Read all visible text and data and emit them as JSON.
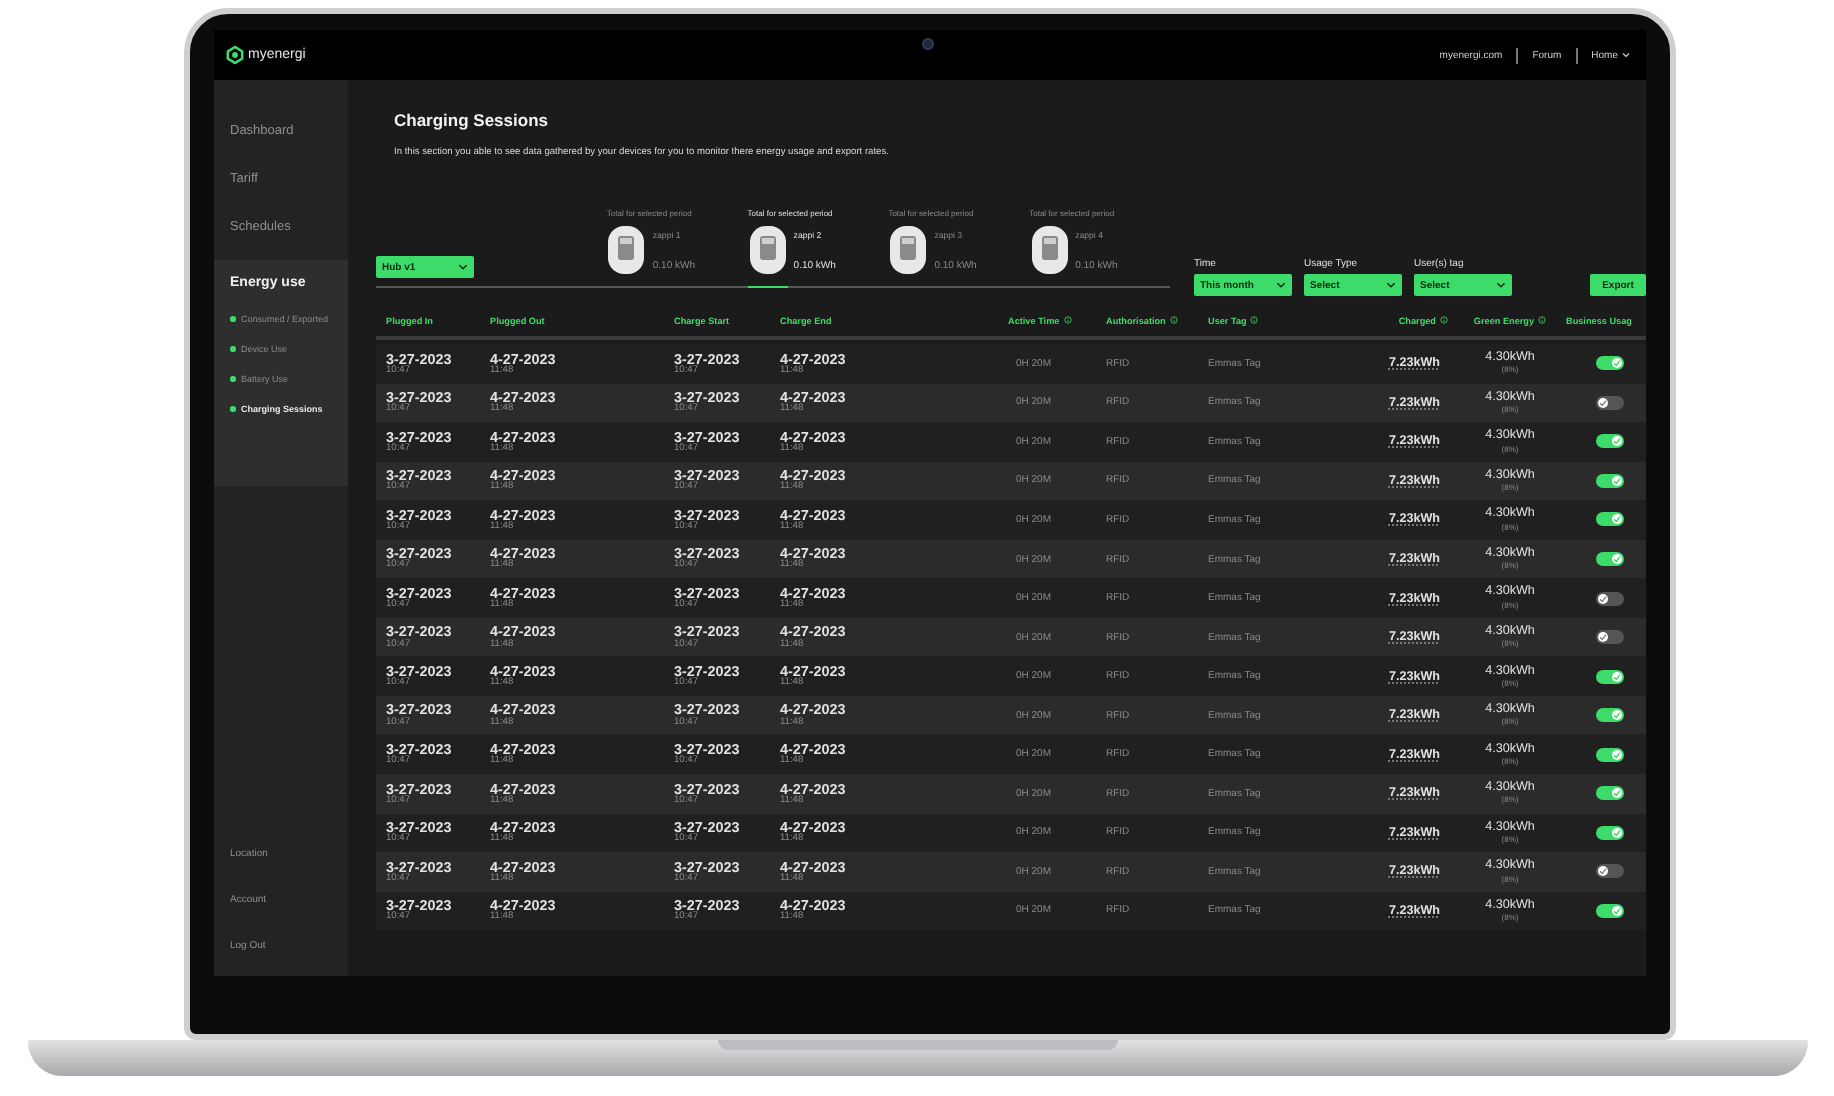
{
  "nav": {
    "logo": "myenergi",
    "links": [
      {
        "label": "myenergi.com",
        "dropdown": false
      },
      {
        "label": "Forum",
        "dropdown": false
      },
      {
        "label": "Home",
        "dropdown": true
      }
    ]
  },
  "sidebar": {
    "items": [
      {
        "label": "Dashboard",
        "selected": false
      },
      {
        "label": "Tariff",
        "selected": false
      },
      {
        "label": "Schedules",
        "selected": false
      },
      {
        "label": "Energy use",
        "selected": true,
        "children": [
          {
            "label": "Consumed / Exported",
            "selected": false
          },
          {
            "label": "Device Use",
            "selected": false
          },
          {
            "label": "Battery Use",
            "selected": false
          },
          {
            "label": "Charging Sessions",
            "selected": true
          }
        ]
      }
    ],
    "footer_items": [
      {
        "label": "Location"
      },
      {
        "label": "Account"
      },
      {
        "label": "Log Out"
      }
    ]
  },
  "page": {
    "title": "Charging Sessions",
    "description": "In this section you able to see data gathered by your devices for you to monitor there energy usage and export rates."
  },
  "hub_select": {
    "value": "Hub v1"
  },
  "devices": [
    {
      "caption": "Total for selected period",
      "name": "zappi 1",
      "energy": "0.10 kWh",
      "selected": false
    },
    {
      "caption": "Total for selected period",
      "name": "zappi 2",
      "energy": "0.10 kWh",
      "selected": true
    },
    {
      "caption": "Total for selected period",
      "name": "zappi 3",
      "energy": "0.10 kWh",
      "selected": false
    },
    {
      "caption": "Total for selected period",
      "name": "zappi 4",
      "energy": "0.10 kWh",
      "selected": false
    }
  ],
  "filters": [
    {
      "label": "Time",
      "value": "This month"
    },
    {
      "label": "Usage Type",
      "value": "Select"
    },
    {
      "label": "User(s) tag",
      "value": "Select"
    }
  ],
  "export_button": "Export",
  "table": {
    "columns": [
      {
        "label": "Plugged In",
        "info": false
      },
      {
        "label": "Plugged Out",
        "info": false
      },
      {
        "label": "Charge Start",
        "info": false
      },
      {
        "label": "Charge End",
        "info": false
      },
      {
        "label": "Active Time",
        "info": true
      },
      {
        "label": "Authorisation",
        "info": true
      },
      {
        "label": "User Tag",
        "info": true
      },
      {
        "label": "Charged",
        "info": true
      },
      {
        "label": "Green Energy",
        "info": true
      },
      {
        "label": "Business Usag",
        "info": false
      }
    ],
    "rows": [
      {
        "plugged_in": [
          "3-27-2023",
          "10:47"
        ],
        "plugged_out": [
          "4-27-2023",
          "11:48"
        ],
        "charge_start": [
          "3-27-2023",
          "10:47"
        ],
        "charge_end": [
          "4-27-2023",
          "11:48"
        ],
        "active_time": "0H  20M",
        "authorisation": "RFID",
        "user_tag": "Emmas Tag",
        "charged": "7.23kWh",
        "green_energy": "4.30kWh",
        "green_share": "(8%)",
        "business_usage": true
      },
      {
        "plugged_in": [
          "3-27-2023",
          "10:47"
        ],
        "plugged_out": [
          "4-27-2023",
          "11:48"
        ],
        "charge_start": [
          "3-27-2023",
          "10:47"
        ],
        "charge_end": [
          "4-27-2023",
          "11:48"
        ],
        "active_time": "0H  20M",
        "authorisation": "RFID",
        "user_tag": "Emmas Tag",
        "charged": "7.23kWh",
        "green_energy": "4.30kWh",
        "green_share": "(8%)",
        "business_usage": false
      },
      {
        "plugged_in": [
          "3-27-2023",
          "10:47"
        ],
        "plugged_out": [
          "4-27-2023",
          "11:48"
        ],
        "charge_start": [
          "3-27-2023",
          "10:47"
        ],
        "charge_end": [
          "4-27-2023",
          "11:48"
        ],
        "active_time": "0H  20M",
        "authorisation": "RFID",
        "user_tag": "Emmas Tag",
        "charged": "7.23kWh",
        "green_energy": "4.30kWh",
        "green_share": "(8%)",
        "business_usage": true
      },
      {
        "plugged_in": [
          "3-27-2023",
          "10:47"
        ],
        "plugged_out": [
          "4-27-2023",
          "11:48"
        ],
        "charge_start": [
          "3-27-2023",
          "10:47"
        ],
        "charge_end": [
          "4-27-2023",
          "11:48"
        ],
        "active_time": "0H  20M",
        "authorisation": "RFID",
        "user_tag": "Emmas Tag",
        "charged": "7.23kWh",
        "green_energy": "4.30kWh",
        "green_share": "(8%)",
        "business_usage": true
      },
      {
        "plugged_in": [
          "3-27-2023",
          "10:47"
        ],
        "plugged_out": [
          "4-27-2023",
          "11:48"
        ],
        "charge_start": [
          "3-27-2023",
          "10:47"
        ],
        "charge_end": [
          "4-27-2023",
          "11:48"
        ],
        "active_time": "0H  20M",
        "authorisation": "RFID",
        "user_tag": "Emmas Tag",
        "charged": "7.23kWh",
        "green_energy": "4.30kWh",
        "green_share": "(8%)",
        "business_usage": true
      },
      {
        "plugged_in": [
          "3-27-2023",
          "10:47"
        ],
        "plugged_out": [
          "4-27-2023",
          "11:48"
        ],
        "charge_start": [
          "3-27-2023",
          "10:47"
        ],
        "charge_end": [
          "4-27-2023",
          "11:48"
        ],
        "active_time": "0H  20M",
        "authorisation": "RFID",
        "user_tag": "Emmas Tag",
        "charged": "7.23kWh",
        "green_energy": "4.30kWh",
        "green_share": "(8%)",
        "business_usage": true
      },
      {
        "plugged_in": [
          "3-27-2023",
          "10:47"
        ],
        "plugged_out": [
          "4-27-2023",
          "11:48"
        ],
        "charge_start": [
          "3-27-2023",
          "10:47"
        ],
        "charge_end": [
          "4-27-2023",
          "11:48"
        ],
        "active_time": "0H  20M",
        "authorisation": "RFID",
        "user_tag": "Emmas Tag",
        "charged": "7.23kWh",
        "green_energy": "4.30kWh",
        "green_share": "(8%)",
        "business_usage": false
      },
      {
        "plugged_in": [
          "3-27-2023",
          "10:47"
        ],
        "plugged_out": [
          "4-27-2023",
          "11:48"
        ],
        "charge_start": [
          "3-27-2023",
          "10:47"
        ],
        "charge_end": [
          "4-27-2023",
          "11:48"
        ],
        "active_time": "0H  20M",
        "authorisation": "RFID",
        "user_tag": "Emmas Tag",
        "charged": "7.23kWh",
        "green_energy": "4.30kWh",
        "green_share": "(8%)",
        "business_usage": false
      },
      {
        "plugged_in": [
          "3-27-2023",
          "10:47"
        ],
        "plugged_out": [
          "4-27-2023",
          "11:48"
        ],
        "charge_start": [
          "3-27-2023",
          "10:47"
        ],
        "charge_end": [
          "4-27-2023",
          "11:48"
        ],
        "active_time": "0H  20M",
        "authorisation": "RFID",
        "user_tag": "Emmas Tag",
        "charged": "7.23kWh",
        "green_energy": "4.30kWh",
        "green_share": "(8%)",
        "business_usage": true
      },
      {
        "plugged_in": [
          "3-27-2023",
          "10:47"
        ],
        "plugged_out": [
          "4-27-2023",
          "11:48"
        ],
        "charge_start": [
          "3-27-2023",
          "10:47"
        ],
        "charge_end": [
          "4-27-2023",
          "11:48"
        ],
        "active_time": "0H  20M",
        "authorisation": "RFID",
        "user_tag": "Emmas Tag",
        "charged": "7.23kWh",
        "green_energy": "4.30kWh",
        "green_share": "(8%)",
        "business_usage": true
      },
      {
        "plugged_in": [
          "3-27-2023",
          "10:47"
        ],
        "plugged_out": [
          "4-27-2023",
          "11:48"
        ],
        "charge_start": [
          "3-27-2023",
          "10:47"
        ],
        "charge_end": [
          "4-27-2023",
          "11:48"
        ],
        "active_time": "0H  20M",
        "authorisation": "RFID",
        "user_tag": "Emmas Tag",
        "charged": "7.23kWh",
        "green_energy": "4.30kWh",
        "green_share": "(8%)",
        "business_usage": true
      },
      {
        "plugged_in": [
          "3-27-2023",
          "10:47"
        ],
        "plugged_out": [
          "4-27-2023",
          "11:48"
        ],
        "charge_start": [
          "3-27-2023",
          "10:47"
        ],
        "charge_end": [
          "4-27-2023",
          "11:48"
        ],
        "active_time": "0H  20M",
        "authorisation": "RFID",
        "user_tag": "Emmas Tag",
        "charged": "7.23kWh",
        "green_energy": "4.30kWh",
        "green_share": "(8%)",
        "business_usage": true
      },
      {
        "plugged_in": [
          "3-27-2023",
          "10:47"
        ],
        "plugged_out": [
          "4-27-2023",
          "11:48"
        ],
        "charge_start": [
          "3-27-2023",
          "10:47"
        ],
        "charge_end": [
          "4-27-2023",
          "11:48"
        ],
        "active_time": "0H  20M",
        "authorisation": "RFID",
        "user_tag": "Emmas Tag",
        "charged": "7.23kWh",
        "green_energy": "4.30kWh",
        "green_share": "(8%)",
        "business_usage": true
      },
      {
        "plugged_in": [
          "3-27-2023",
          "10:47"
        ],
        "plugged_out": [
          "4-27-2023",
          "11:48"
        ],
        "charge_start": [
          "3-27-2023",
          "10:47"
        ],
        "charge_end": [
          "4-27-2023",
          "11:48"
        ],
        "active_time": "0H  20M",
        "authorisation": "RFID",
        "user_tag": "Emmas Tag",
        "charged": "7.23kWh",
        "green_energy": "4.30kWh",
        "green_share": "(8%)",
        "business_usage": false
      },
      {
        "plugged_in": [
          "3-27-2023",
          "10:47"
        ],
        "plugged_out": [
          "4-27-2023",
          "11:48"
        ],
        "charge_start": [
          "3-27-2023",
          "10:47"
        ],
        "charge_end": [
          "4-27-2023",
          "11:48"
        ],
        "active_time": "0H  20M",
        "authorisation": "RFID",
        "user_tag": "Emmas Tag",
        "charged": "7.23kWh",
        "green_energy": "4.30kWh",
        "green_share": "(8%)",
        "business_usage": true
      }
    ]
  }
}
